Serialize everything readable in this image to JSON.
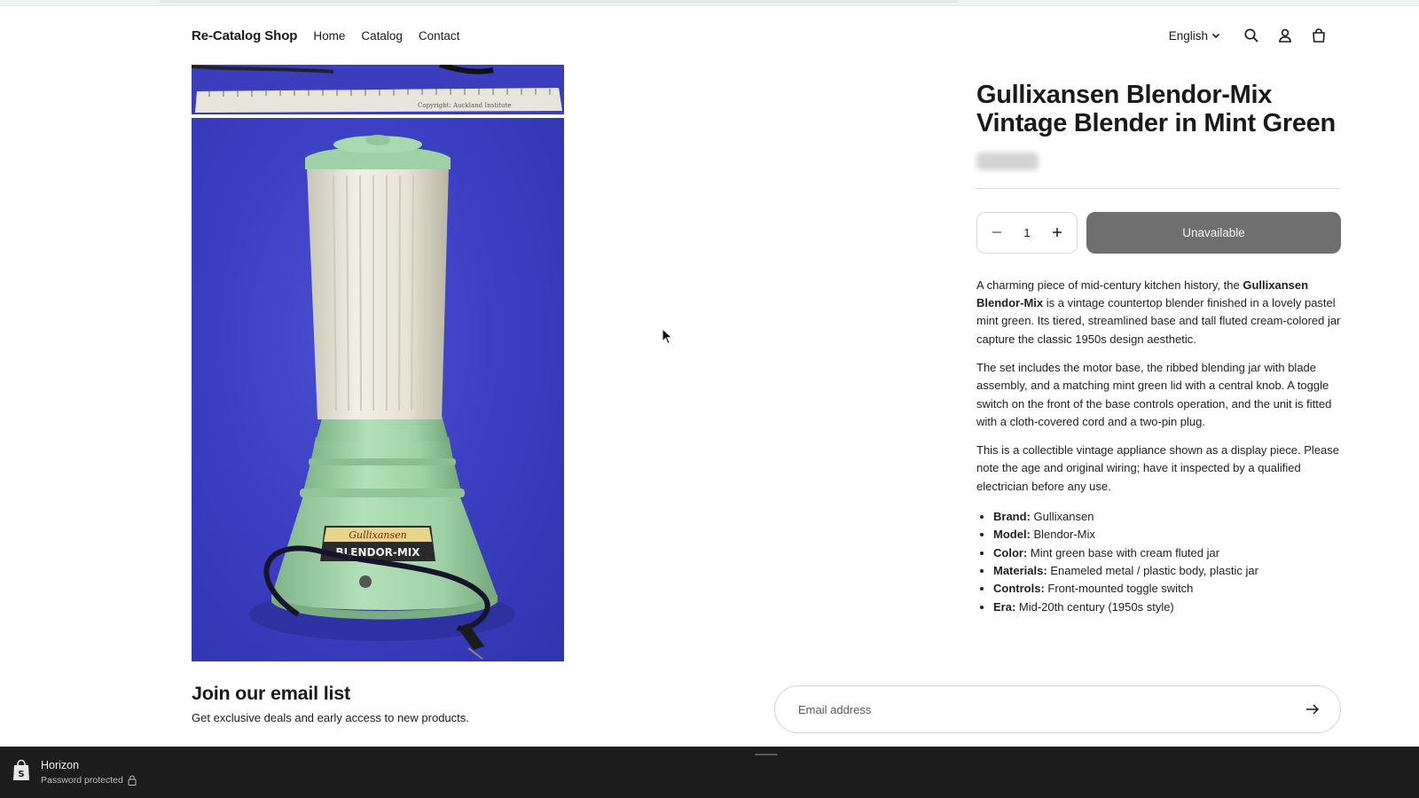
{
  "header": {
    "logo": "Re-Catalog Shop",
    "nav": [
      "Home",
      "Catalog",
      "Contact"
    ],
    "language": "English",
    "icons": [
      "search-icon",
      "account-icon",
      "cart-icon"
    ]
  },
  "gallery": {
    "ruler_text": "Copyright: Auckland Institute",
    "label_brand": "Gullixansen",
    "label_model": "BLENDOR-MIX"
  },
  "product": {
    "title": "Gullixansen Blendor-Mix Vintage Blender in Mint Green",
    "quantity": "1",
    "button_label": "Unavailable",
    "description": {
      "p1_before": "A charming piece of mid-century kitchen history, the ",
      "p1_bold": "Gullixansen Blendor-Mix",
      "p1_after": " is a vintage countertop blender finished in a lovely pastel mint green. Its tiered, streamlined base and tall fluted cream-colored jar capture the classic 1950s design aesthetic.",
      "p2": "The set includes the motor base, the ribbed blending jar with blade assembly, and a matching mint green lid with a central knob. A toggle switch on the front of the base controls operation, and the unit is fitted with a cloth-covered cord and a two-pin plug.",
      "p3": "This is a collectible vintage appliance shown as a display piece. Please note the age and original wiring; have it inspected by a qualified electrician before any use."
    },
    "specs": [
      {
        "label": "Brand:",
        "value": " Gullixansen"
      },
      {
        "label": "Model:",
        "value": " Blendor-Mix"
      },
      {
        "label": "Color:",
        "value": " Mint green base with cream fluted jar"
      },
      {
        "label": "Materials:",
        "value": " Enameled metal / plastic body, plastic jar"
      },
      {
        "label": "Controls:",
        "value": " Front-mounted toggle switch"
      },
      {
        "label": "Era:",
        "value": " Mid-20th century (1950s style)"
      }
    ]
  },
  "newsletter": {
    "title": "Join our email list",
    "subtitle": "Get exclusive deals and early access to new products.",
    "placeholder": "Email address"
  },
  "bottom_bar": {
    "store_name": "Horizon",
    "status": "Password protected"
  },
  "colors": {
    "background_blue": "#3a3dc0",
    "mint": "#a6d9ae",
    "button_gray": "#6f6f6f",
    "bar_dark": "#1c1c1c"
  }
}
